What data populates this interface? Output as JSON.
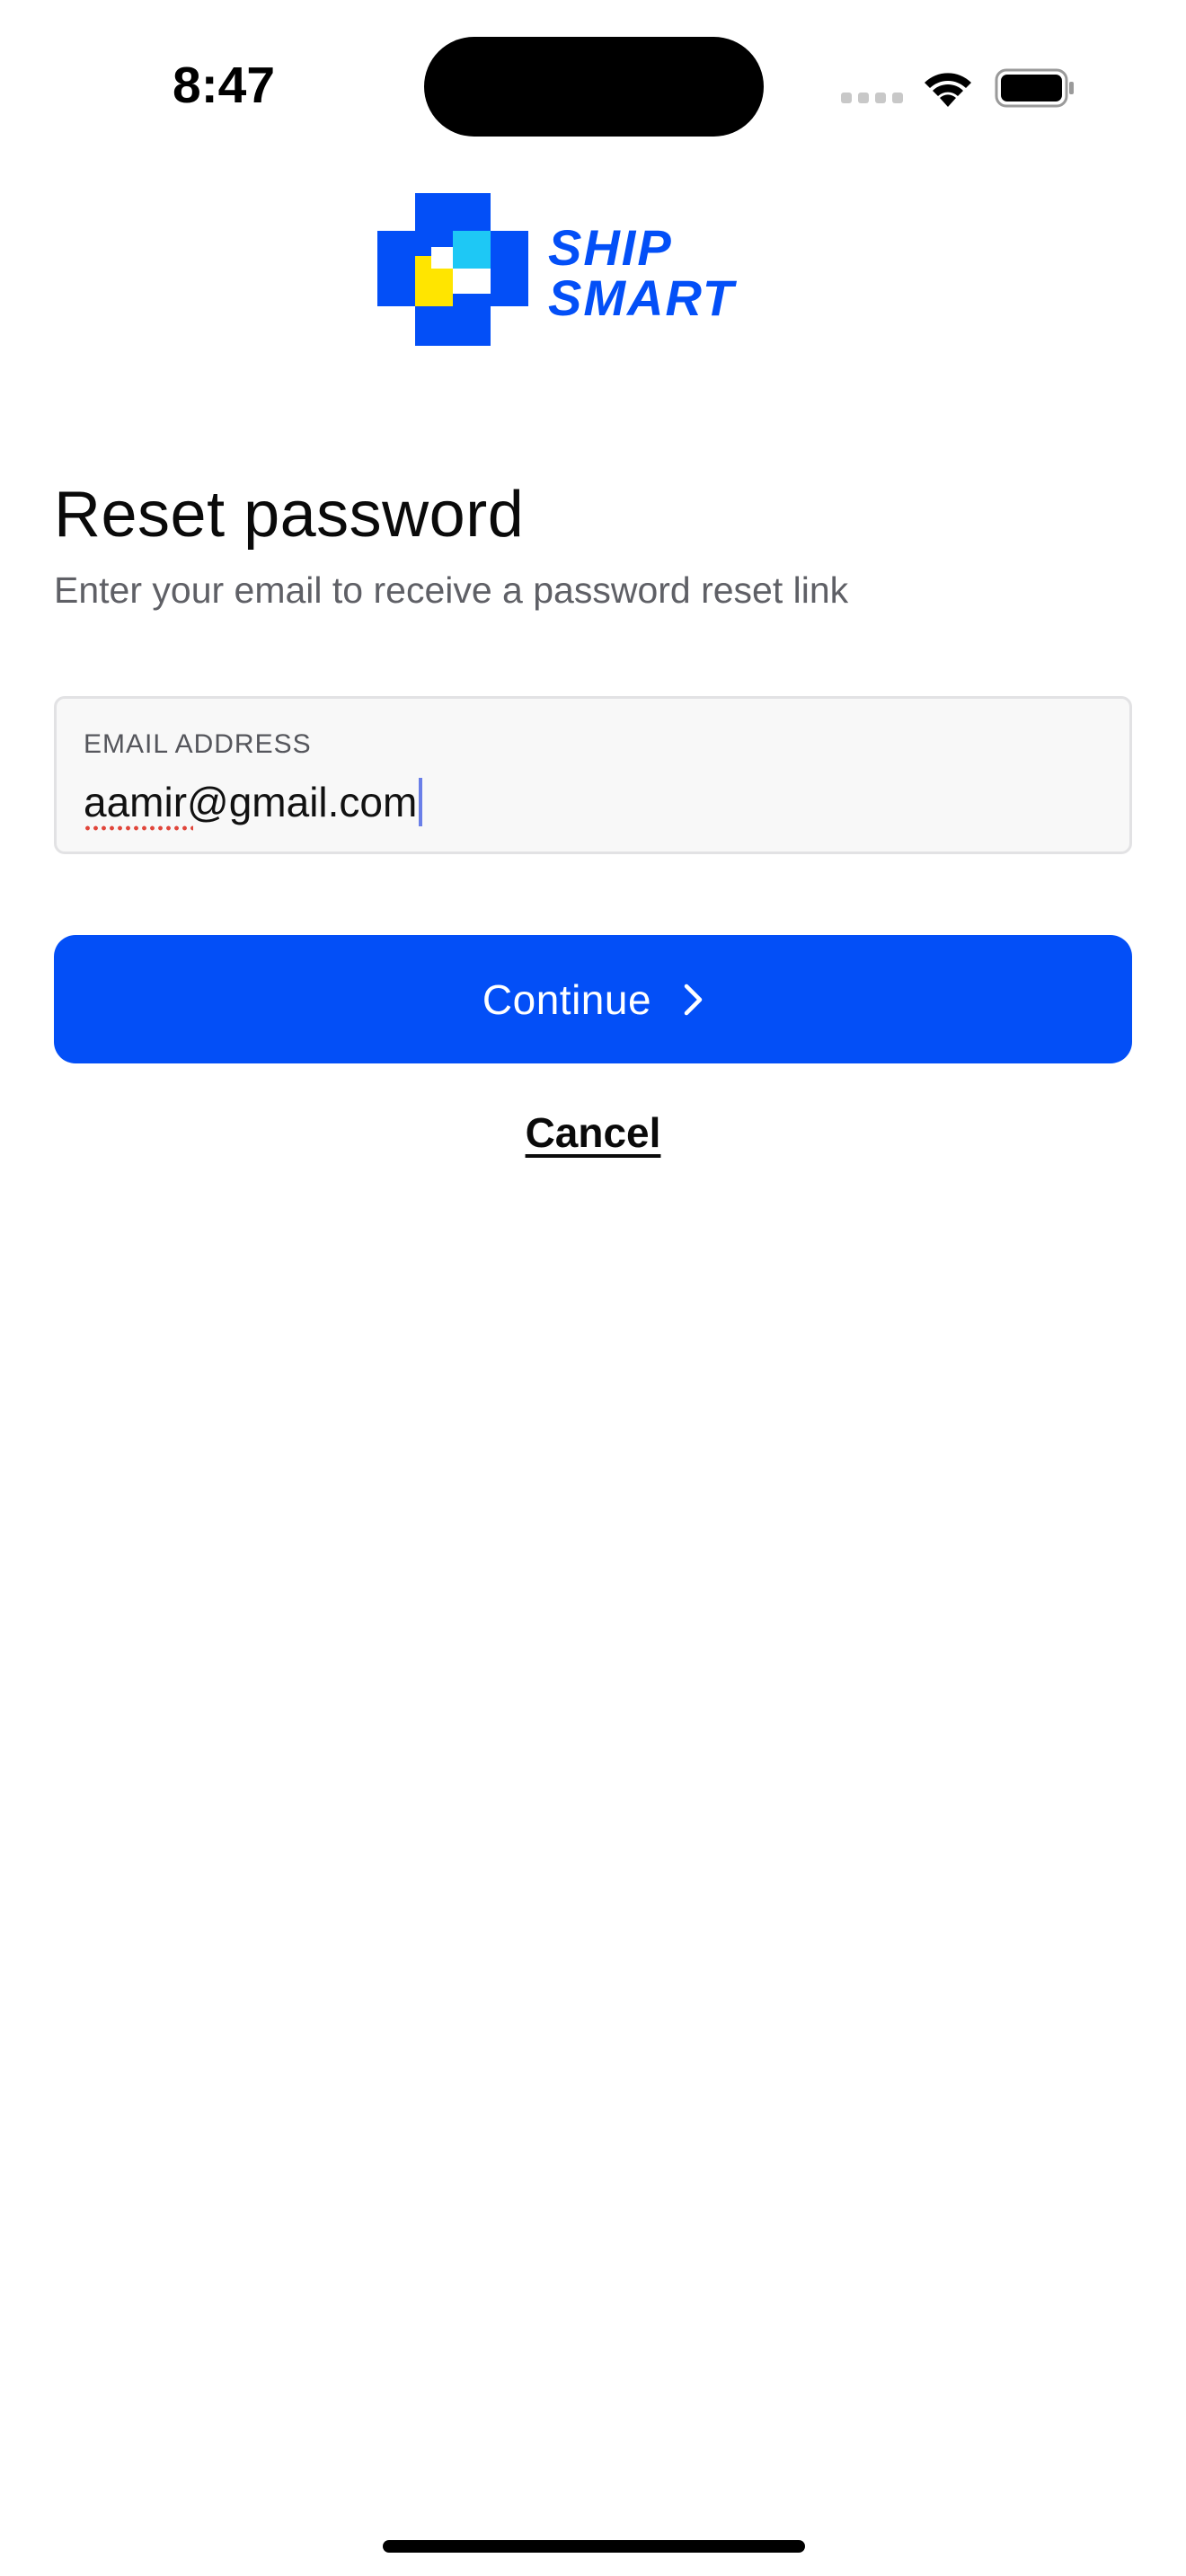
{
  "status_bar": {
    "time": "8:47"
  },
  "brand": {
    "logo_text": "SHIP SMART",
    "colors": {
      "primary": "#034ff7",
      "cyan": "#1ec8f5",
      "yellow": "#ffe500"
    }
  },
  "header": {
    "title": "Reset password",
    "subtitle": "Enter your email to receive a password reset link"
  },
  "email_field": {
    "label": "EMAIL ADDRESS",
    "value": "aamir@gmail.com"
  },
  "actions": {
    "continue_label": "Continue",
    "continue_icon": "chevron-right-icon",
    "cancel_label": "Cancel"
  },
  "colors": {
    "button": "#034ff7",
    "field_bg": "#f8f8f8",
    "subtitle": "#5f6066"
  }
}
